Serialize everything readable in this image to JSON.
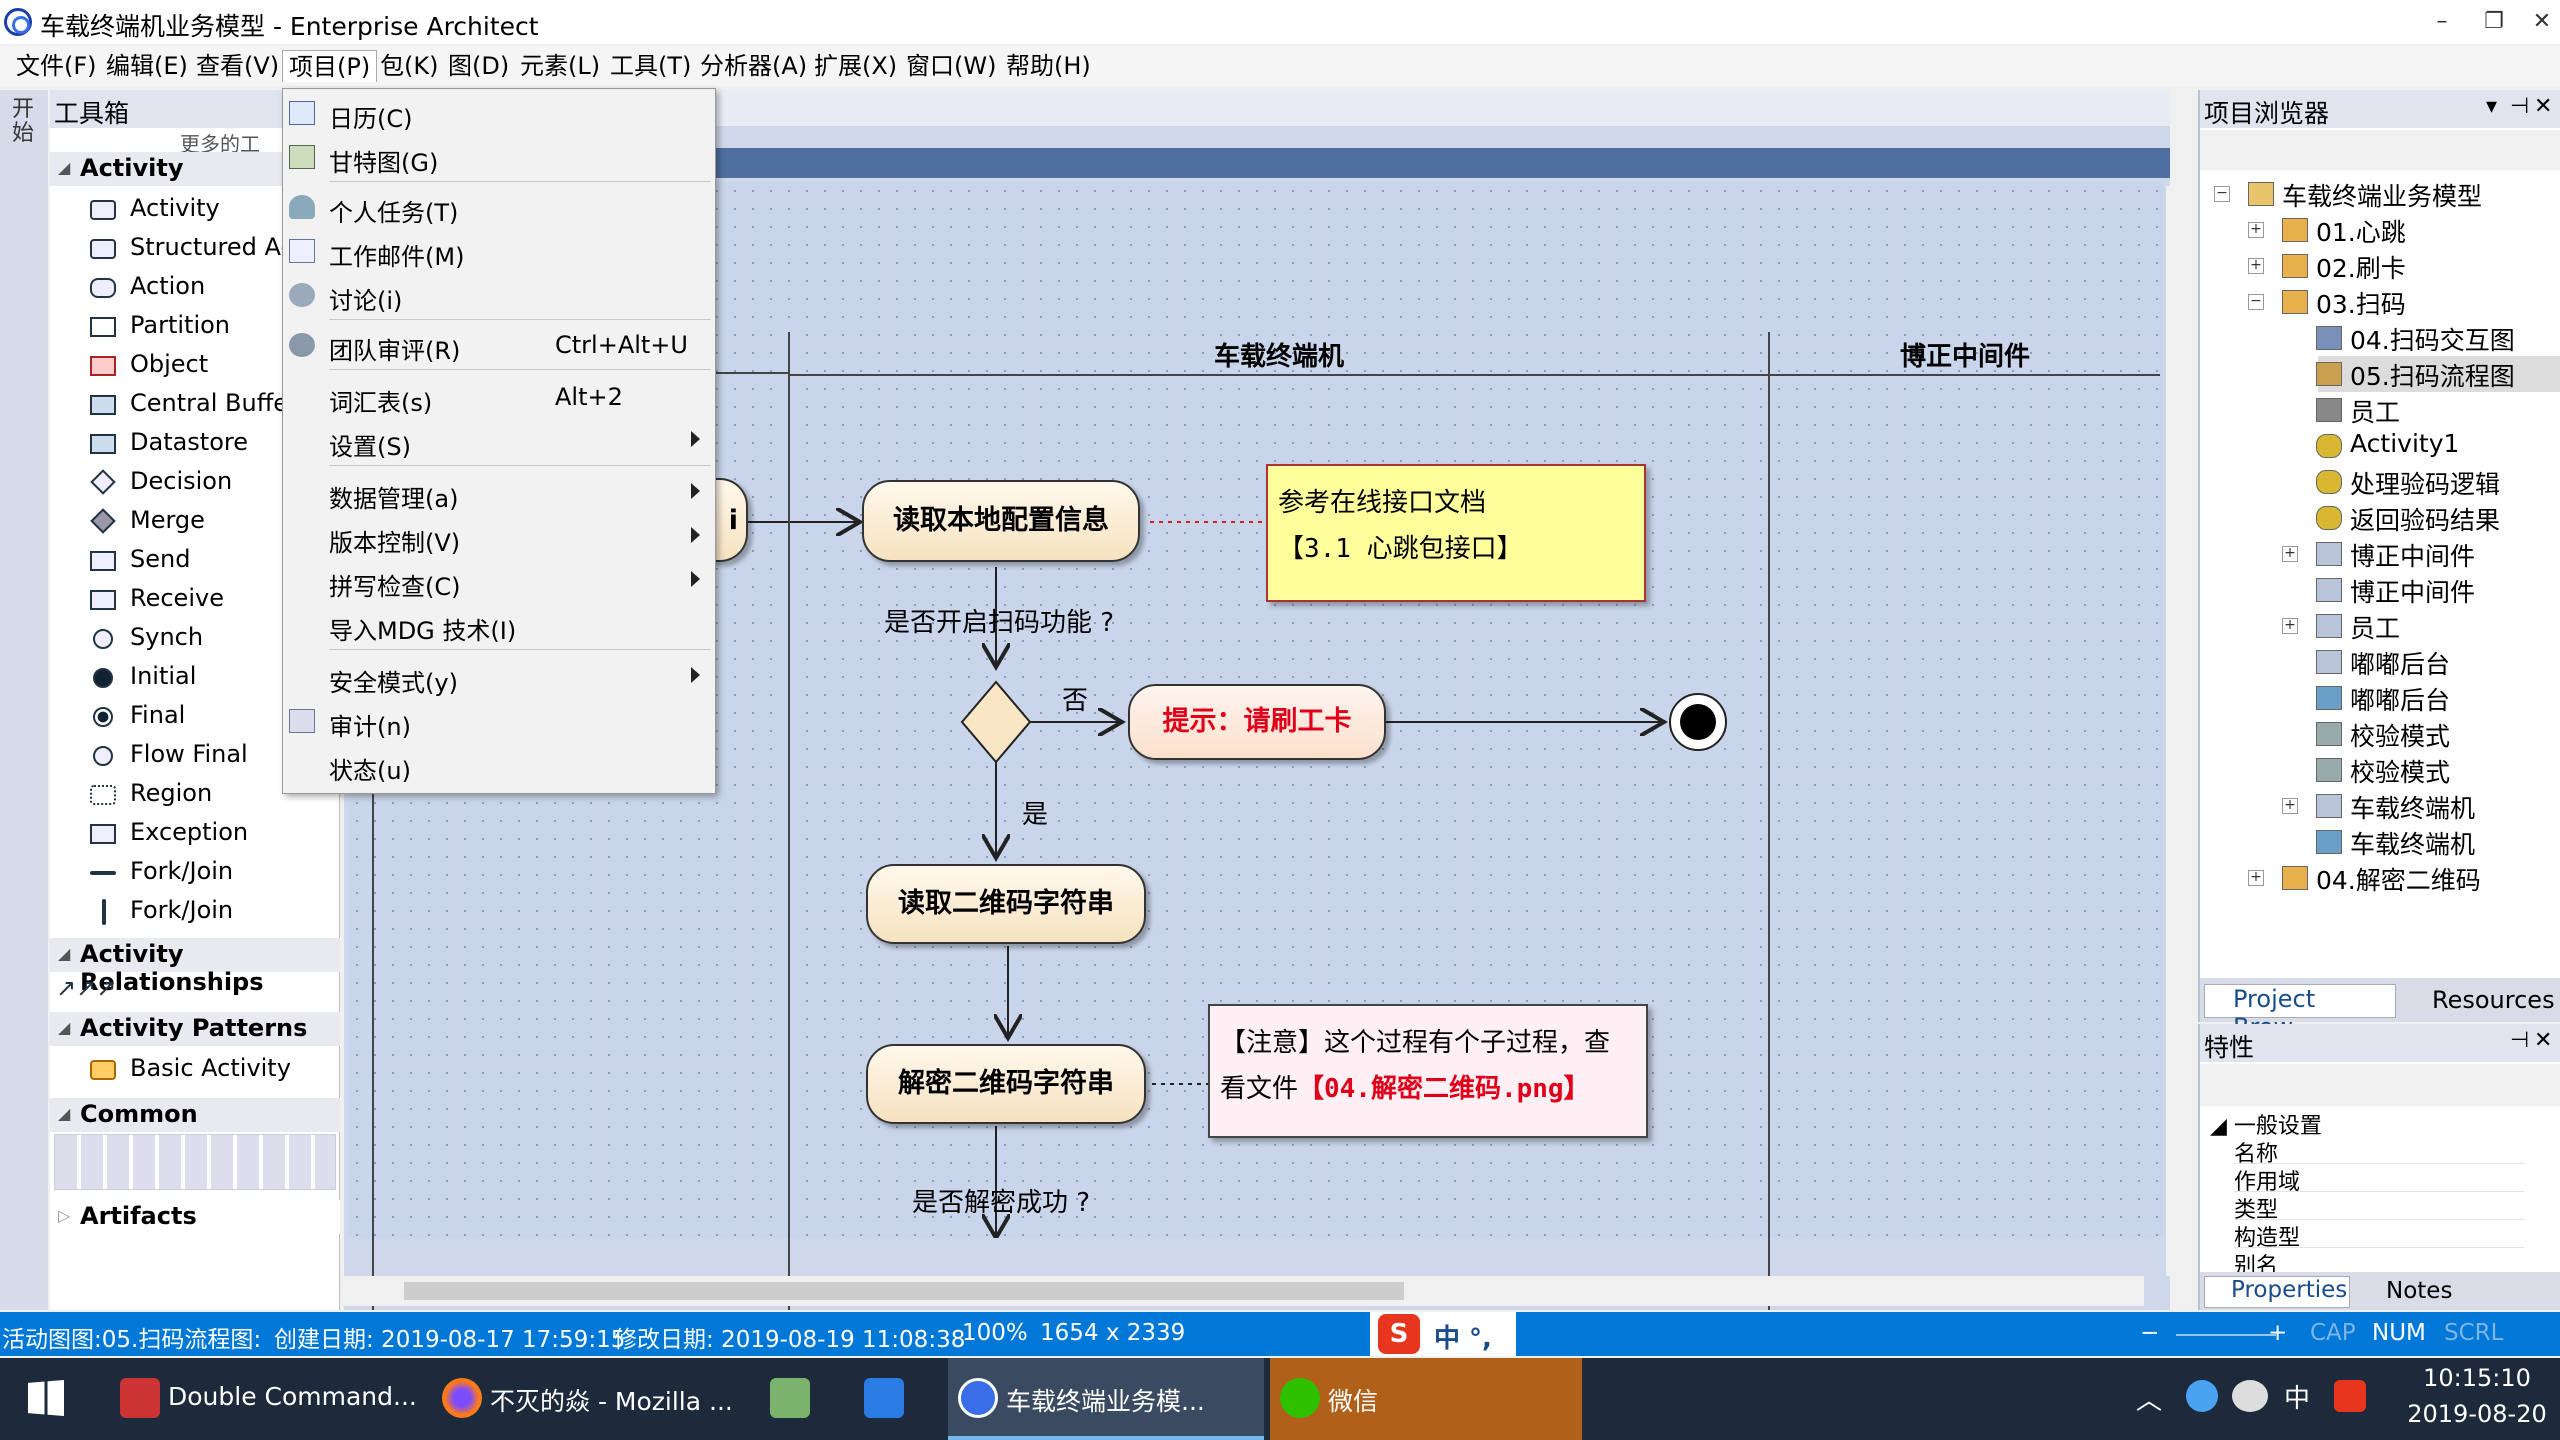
{
  "window": {
    "title": "车载终端机业务模型 - Enterprise Architect",
    "minimize": "–",
    "restore": "❐",
    "close": "✕"
  },
  "menubar": [
    {
      "label": "文件(F)"
    },
    {
      "label": "编辑(E)"
    },
    {
      "label": "查看(V)"
    },
    {
      "label": "项目(P)"
    },
    {
      "label": "包(K)"
    },
    {
      "label": "图(D)"
    },
    {
      "label": "元素(L)"
    },
    {
      "label": "工具(T)"
    },
    {
      "label": "分析器(A)"
    },
    {
      "label": "扩展(X)"
    },
    {
      "label": "窗口(W)"
    },
    {
      "label": "帮助(H)"
    }
  ],
  "left_strip": {
    "label": "开始"
  },
  "toolbox": {
    "title": "工具箱",
    "subtitle": "更多的工",
    "groups": {
      "activity": "Activity",
      "activity_relationships": "Activity Relationships",
      "activity_patterns": "Activity Patterns",
      "common": "Common",
      "artifacts": "Artifacts"
    },
    "items": [
      "Activity",
      "Structured Ac",
      "Action",
      "Partition",
      "Object",
      "Central Buffer",
      "Datastore",
      "Decision",
      "Merge",
      "Send",
      "Receive",
      "Synch",
      "Initial",
      "Final",
      "Flow Final",
      "Region",
      "Exception",
      "Fork/Join",
      "Fork/Join"
    ],
    "pattern_item": "Basic Activity"
  },
  "dropdown": {
    "items": [
      {
        "label": "日历(C)",
        "shortcut": "",
        "submenu": false,
        "icon": "calendar-icon"
      },
      {
        "label": "甘特图(G)",
        "shortcut": "",
        "submenu": false,
        "icon": "gantt-icon"
      },
      {
        "label": "个人任务(T)",
        "shortcut": "",
        "submenu": false,
        "icon": "person-icon"
      },
      {
        "label": "工作邮件(M)",
        "shortcut": "",
        "submenu": false,
        "icon": "mail-icon"
      },
      {
        "label": "讨论(i)",
        "shortcut": "",
        "submenu": false,
        "icon": "discussion-icon"
      },
      {
        "label": "团队审评(R)",
        "shortcut": "Ctrl+Alt+U",
        "submenu": false,
        "icon": "team-review-icon"
      },
      {
        "label": "词汇表(s)",
        "shortcut": "Alt+2",
        "submenu": false,
        "icon": ""
      },
      {
        "label": "设置(S)",
        "shortcut": "",
        "submenu": true,
        "icon": ""
      },
      {
        "label": "数据管理(a)",
        "shortcut": "",
        "submenu": true,
        "icon": ""
      },
      {
        "label": "版本控制(V)",
        "shortcut": "",
        "submenu": true,
        "icon": ""
      },
      {
        "label": "拼写检查(C)",
        "shortcut": "",
        "submenu": true,
        "icon": ""
      },
      {
        "label": "导入MDG 技术(I)",
        "shortcut": "",
        "submenu": false,
        "icon": ""
      },
      {
        "label": "安全模式(y)",
        "shortcut": "",
        "submenu": true,
        "icon": ""
      },
      {
        "label": "审计(n)",
        "shortcut": "",
        "submenu": false,
        "icon": "audit-icon"
      },
      {
        "label": "状态(u)",
        "shortcut": "",
        "submenu": false,
        "icon": ""
      }
    ]
  },
  "diagram": {
    "lanes": [
      "车载终端机",
      "博正中间件"
    ],
    "partial_node_text": "i",
    "nodes": {
      "read_config": "读取本地配置信息",
      "prompt_swipe": "提示：请刷工卡",
      "read_qr": "读取二维码字符串",
      "decrypt_qr": "解密二维码字符串"
    },
    "labels": {
      "scan_enabled_question": "是否开启扫码功能 ?",
      "no": "否",
      "yes": "是",
      "decrypt_success_question": "是否解密成功 ?"
    },
    "note1": {
      "line1": "参考在线接口文档",
      "line2": "【3.1 心跳包接口】"
    },
    "note2": {
      "line1": "【注意】这个过程有个子过程，查",
      "line2_prefix": "看文件",
      "line2_link": "【04.解密二维码.png】"
    }
  },
  "browser": {
    "title": "项目浏览器",
    "tree": [
      {
        "label": "车载终端业务模型",
        "indent": 0,
        "expander": "−",
        "icon": "package-root-icon",
        "selected": false
      },
      {
        "label": "01.心跳",
        "indent": 1,
        "expander": "+",
        "icon": "package-icon",
        "selected": false
      },
      {
        "label": "02.刷卡",
        "indent": 1,
        "expander": "+",
        "icon": "package-icon",
        "selected": false
      },
      {
        "label": "03.扫码",
        "indent": 1,
        "expander": "−",
        "icon": "package-icon",
        "selected": false
      },
      {
        "label": "04.扫码交互图",
        "indent": 2,
        "expander": "",
        "icon": "interaction-diagram-icon",
        "selected": false
      },
      {
        "label": "05.扫码流程图",
        "indent": 2,
        "expander": "",
        "icon": "activity-diagram-icon",
        "selected": true
      },
      {
        "label": "员工",
        "indent": 2,
        "expander": "",
        "icon": "actor-icon",
        "selected": false
      },
      {
        "label": "Activity1",
        "indent": 2,
        "expander": "",
        "icon": "activity-icon",
        "selected": false
      },
      {
        "label": "处理验码逻辑",
        "indent": 2,
        "expander": "",
        "icon": "activity-icon",
        "selected": false
      },
      {
        "label": "返回验码结果",
        "indent": 2,
        "expander": "",
        "icon": "activity-icon",
        "selected": false
      },
      {
        "label": "博正中间件",
        "indent": 2,
        "expander": "+",
        "icon": "partition-icon",
        "selected": false
      },
      {
        "label": "博正中间件",
        "indent": 2,
        "expander": "",
        "icon": "partition-icon",
        "selected": false
      },
      {
        "label": "员工",
        "indent": 2,
        "expander": "+",
        "icon": "partition-icon",
        "selected": false
      },
      {
        "label": "嘟嘟后台",
        "indent": 2,
        "expander": "",
        "icon": "partition-icon",
        "selected": false
      },
      {
        "label": "嘟嘟后台",
        "indent": 2,
        "expander": "",
        "icon": "screen-icon",
        "selected": false
      },
      {
        "label": "校验模式",
        "indent": 2,
        "expander": "",
        "icon": "class-icon",
        "selected": false
      },
      {
        "label": "校验模式",
        "indent": 2,
        "expander": "",
        "icon": "class-icon",
        "selected": false
      },
      {
        "label": "车载终端机",
        "indent": 2,
        "expander": "+",
        "icon": "partition-icon",
        "selected": false
      },
      {
        "label": "车载终端机",
        "indent": 2,
        "expander": "",
        "icon": "screen-icon",
        "selected": false
      },
      {
        "label": "04.解密二维码",
        "indent": 1,
        "expander": "+",
        "icon": "package-icon",
        "selected": false
      }
    ],
    "tabs": [
      "Project Brow...",
      "Resources"
    ]
  },
  "properties": {
    "title": "特性",
    "section": "一般设置",
    "rows": [
      "名称",
      "作用域",
      "类型",
      "构造型",
      "别名"
    ],
    "tabs": [
      "Properties",
      "Notes"
    ]
  },
  "statusbar": {
    "diagram": "活动图图:05.扫码流程图:",
    "created": "创建日期: 2019-08-17 17:59:15",
    "modified": "修改日期: 2019-08-19 11:08:38",
    "zoom": "100%",
    "size": "1654 x 2339",
    "ime": "中 °,",
    "cap": "CAP",
    "num": "NUM",
    "scrl": "SCRL"
  },
  "taskbar": {
    "items": [
      {
        "label": "Double Command...",
        "icon": "double-commander-icon",
        "active": false
      },
      {
        "label": "不灭的焱 - Mozilla ...",
        "icon": "firefox-icon",
        "active": false
      },
      {
        "label": "",
        "icon": "app-icon",
        "active": false
      },
      {
        "label": "",
        "icon": "pen-app-icon",
        "active": false
      },
      {
        "label": "车载终端业务模...",
        "icon": "enterprise-architect-icon",
        "active": true
      },
      {
        "label": "微信",
        "icon": "wechat-icon",
        "active": false
      }
    ],
    "tray_ime": "中",
    "time": "10:15:10",
    "date": "2019-08-20"
  },
  "colors": {
    "accent": "#0078d7",
    "taskbar": "#1c2a3c",
    "node_fill": "#f6e2c0",
    "note_yellow": "#ffff9c",
    "note_pink": "#fff0f5",
    "red_text": "#e0001a"
  }
}
